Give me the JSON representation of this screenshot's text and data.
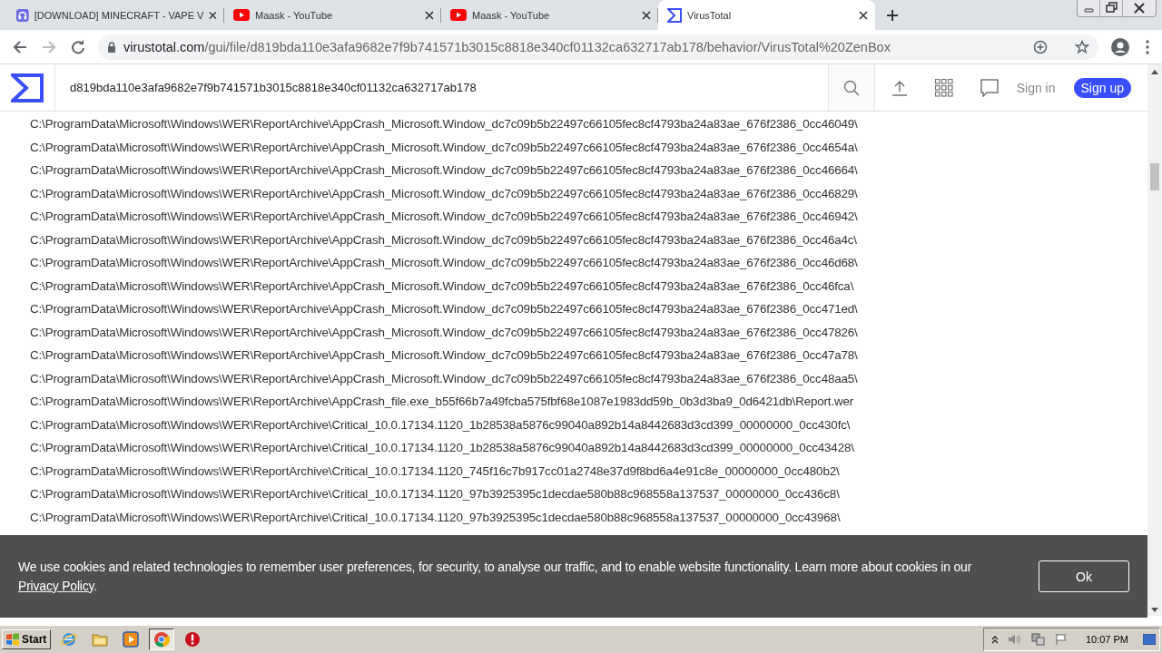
{
  "browser": {
    "tabs": [
      {
        "title": "[DOWNLOAD] MINECRAFT - VAPE V",
        "kind": "site",
        "selected": false
      },
      {
        "title": "Maask - YouTube",
        "kind": "youtube",
        "selected": false
      },
      {
        "title": "Maask - YouTube",
        "kind": "youtube",
        "selected": false
      },
      {
        "title": "VirusTotal",
        "kind": "virustotal",
        "selected": true
      }
    ],
    "url_host": "virustotal.com",
    "url_path": "/gui/file/d819bda110e3afa9682e7f9b741571b3015c8818e340cf01132ca632717ab178/behavior/VirusTotal%20ZenBox"
  },
  "site": {
    "search_value": "d819bda110e3afa9682e7f9b741571b3015c8818e340cf01132ca632717ab178",
    "sign_in": "Sign in",
    "sign_up": "Sign up"
  },
  "paths": [
    "C:\\ProgramData\\Microsoft\\Windows\\WER\\ReportArchive\\AppCrash_Microsoft.Window_dc7c09b5b22497c66105fec8cf4793ba24a83ae_676f2386_0cc46049\\",
    "C:\\ProgramData\\Microsoft\\Windows\\WER\\ReportArchive\\AppCrash_Microsoft.Window_dc7c09b5b22497c66105fec8cf4793ba24a83ae_676f2386_0cc4654a\\",
    "C:\\ProgramData\\Microsoft\\Windows\\WER\\ReportArchive\\AppCrash_Microsoft.Window_dc7c09b5b22497c66105fec8cf4793ba24a83ae_676f2386_0cc46664\\",
    "C:\\ProgramData\\Microsoft\\Windows\\WER\\ReportArchive\\AppCrash_Microsoft.Window_dc7c09b5b22497c66105fec8cf4793ba24a83ae_676f2386_0cc46829\\",
    "C:\\ProgramData\\Microsoft\\Windows\\WER\\ReportArchive\\AppCrash_Microsoft.Window_dc7c09b5b22497c66105fec8cf4793ba24a83ae_676f2386_0cc46942\\",
    "C:\\ProgramData\\Microsoft\\Windows\\WER\\ReportArchive\\AppCrash_Microsoft.Window_dc7c09b5b22497c66105fec8cf4793ba24a83ae_676f2386_0cc46a4c\\",
    "C:\\ProgramData\\Microsoft\\Windows\\WER\\ReportArchive\\AppCrash_Microsoft.Window_dc7c09b5b22497c66105fec8cf4793ba24a83ae_676f2386_0cc46d68\\",
    "C:\\ProgramData\\Microsoft\\Windows\\WER\\ReportArchive\\AppCrash_Microsoft.Window_dc7c09b5b22497c66105fec8cf4793ba24a83ae_676f2386_0cc46fca\\",
    "C:\\ProgramData\\Microsoft\\Windows\\WER\\ReportArchive\\AppCrash_Microsoft.Window_dc7c09b5b22497c66105fec8cf4793ba24a83ae_676f2386_0cc471ed\\",
    "C:\\ProgramData\\Microsoft\\Windows\\WER\\ReportArchive\\AppCrash_Microsoft.Window_dc7c09b5b22497c66105fec8cf4793ba24a83ae_676f2386_0cc47826\\",
    "C:\\ProgramData\\Microsoft\\Windows\\WER\\ReportArchive\\AppCrash_Microsoft.Window_dc7c09b5b22497c66105fec8cf4793ba24a83ae_676f2386_0cc47a78\\",
    "C:\\ProgramData\\Microsoft\\Windows\\WER\\ReportArchive\\AppCrash_Microsoft.Window_dc7c09b5b22497c66105fec8cf4793ba24a83ae_676f2386_0cc48aa5\\",
    "C:\\ProgramData\\Microsoft\\Windows\\WER\\ReportArchive\\AppCrash_file.exe_b55f66b7a49fcba575fbf68e1087e1983dd59b_0b3d3ba9_0d6421db\\Report.wer",
    "C:\\ProgramData\\Microsoft\\Windows\\WER\\ReportArchive\\Critical_10.0.17134.1120_1b28538a5876c99040a892b14a8442683d3cd399_00000000_0cc430fc\\",
    "C:\\ProgramData\\Microsoft\\Windows\\WER\\ReportArchive\\Critical_10.0.17134.1120_1b28538a5876c99040a892b14a8442683d3cd399_00000000_0cc43428\\",
    "C:\\ProgramData\\Microsoft\\Windows\\WER\\ReportArchive\\Critical_10.0.17134.1120_745f16c7b917cc01a2748e37d9f8bd6a4e91c8e_00000000_0cc480b2\\",
    "C:\\ProgramData\\Microsoft\\Windows\\WER\\ReportArchive\\Critical_10.0.17134.1120_97b3925395c1decdae580b88c968558a137537_00000000_0cc436c8\\",
    "C:\\ProgramData\\Microsoft\\Windows\\WER\\ReportArchive\\Critical_10.0.17134.1120_97b3925395c1decdae580b88c968558a137537_00000000_0cc43968\\"
  ],
  "cookie_banner": {
    "text": "We use cookies and related technologies to remember user preferences, for security, to analyse our traffic, and to enable website functionality. Learn more about cookies in our",
    "link": "Privacy Policy",
    "after": ".",
    "button": "Ok"
  },
  "taskbar": {
    "start": "Start",
    "apps": [
      {
        "kind": "ie",
        "selected": false
      },
      {
        "kind": "folder",
        "selected": false
      },
      {
        "kind": "media",
        "selected": false
      },
      {
        "kind": "chrome",
        "selected": true
      },
      {
        "kind": "stop",
        "selected": false
      }
    ],
    "clock": "10:07 PM"
  }
}
